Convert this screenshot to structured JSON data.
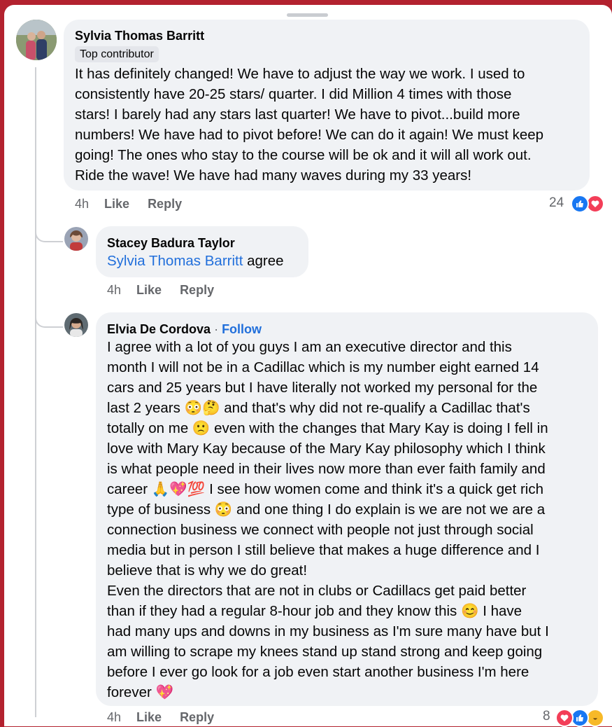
{
  "comments": [
    {
      "author": "Sylvia Thomas Barritt",
      "badge": "Top contributor",
      "lines": [
        "It has definitely changed! We have to adjust the way we work. I used to",
        "consistently have 20-25 stars/ quarter. I did Million 4 times with those",
        "stars! I barely had any stars last quarter! We have to pivot...build more",
        "numbers! We have had to pivot before! We can do it again! We must keep",
        "going! The ones who stay to the course will be ok and it will all work out.",
        "Ride the wave! We have had many waves during my 33 years!"
      ],
      "time": "4h",
      "like": "Like",
      "reply": "Reply",
      "reaction_count": "24",
      "reactions": [
        "like",
        "love"
      ]
    },
    {
      "author": "Stacey Badura Taylor",
      "mention": "Sylvia Thomas Barritt",
      "text_after_mention": " agree",
      "time": "4h",
      "like": "Like",
      "reply": "Reply"
    },
    {
      "author": "Elvia De Cordova",
      "separator": " · ",
      "follow": "Follow",
      "lines": [
        "I agree with a lot of you guys I am an executive director and this",
        "month I will not be in a Cadillac which is my number eight earned 14",
        "cars and 25 years but I have literally not worked my personal for the",
        "last 2 years 😳🤔 and that's why did not re-qualify a Cadillac that's",
        "totally on me 🙁 even with the changes that Mary Kay is doing I fell in",
        "love with Mary Kay because of the Mary Kay philosophy which I think",
        "is what people need in their lives now more than ever faith family and",
        "career 🙏💖💯 I see how women come and think it's a quick get rich",
        "type of business 😳 and one thing I do explain is we are not we are a",
        "connection business we connect with people not just through social",
        "media but in person I still believe that makes a huge difference and I",
        "believe that is why we do great!",
        "Even the directors that are not in clubs or Cadillacs get paid better",
        "than if they had a regular 8-hour job and they know this 😊 I have",
        "had many ups and downs in my business as I'm sure many have but I",
        "am willing to scrape my knees stand up stand strong and keep going",
        "before I ever go look for a job even start another business I'm here",
        "forever 💖"
      ],
      "time": "4h",
      "like": "Like",
      "reply": "Reply",
      "reaction_count": "8",
      "reactions": [
        "love",
        "like",
        "haha"
      ]
    }
  ],
  "icons": {
    "like_icon": "👍",
    "love_icon": "♥",
    "haha_icon": "😆"
  },
  "colors": {
    "background_top": "#b3222f",
    "bubble": "#f0f2f5",
    "link": "#216fdb",
    "secondary_text": "#65676b",
    "like_blue": "#1877f2",
    "love_red": "#f33e58"
  }
}
